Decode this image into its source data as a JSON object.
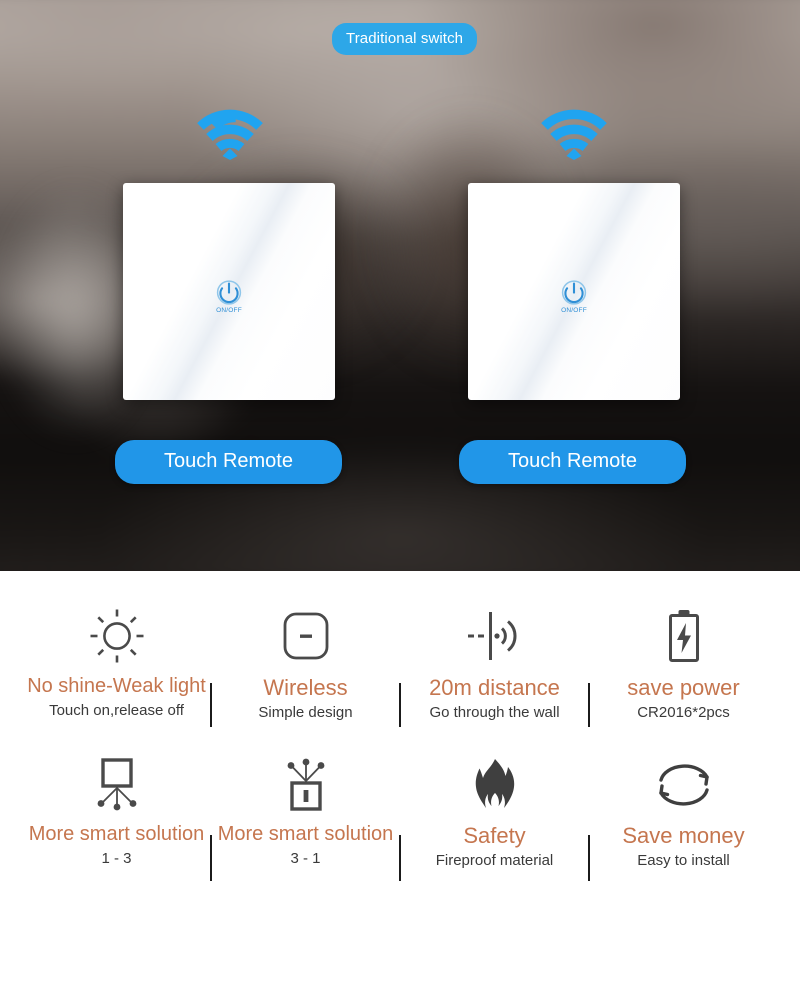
{
  "hero": {
    "badge": {
      "label": "Traditional switch"
    },
    "switches": [
      {
        "wifi_icon": "wifi-signal-icon",
        "power_icon": "power-onoff-icon",
        "power_label": "ON/OFF",
        "button_label": "Touch Remote"
      },
      {
        "wifi_icon": "wifi-signal-icon",
        "power_icon": "power-onoff-icon",
        "power_label": "ON/OFF",
        "button_label": "Touch Remote"
      }
    ]
  },
  "features": {
    "accent_color": "#c5764f",
    "subtext_color": "#3a3a3a",
    "badge_color": "#2da7e8",
    "button_color": "#2196e8",
    "row1": [
      {
        "icon": "sun-icon",
        "title": "No shine-Weak light",
        "subtitle": "Touch on,release off"
      },
      {
        "icon": "wireless-switch-icon",
        "title": "Wireless",
        "subtitle": "Simple design"
      },
      {
        "icon": "through-wall-signal-icon",
        "title": "20m distance",
        "subtitle": "Go through the wall"
      },
      {
        "icon": "battery-bolt-icon",
        "title": "save power",
        "subtitle": "CR2016*2pcs"
      }
    ],
    "row2": [
      {
        "icon": "one-to-three-icon",
        "title": "More smart solution",
        "subtitle": "1 - 3"
      },
      {
        "icon": "three-to-one-icon",
        "title": "More smart solution",
        "subtitle": "3 - 1"
      },
      {
        "icon": "flame-icon",
        "title": "Safety",
        "subtitle": "Fireproof material"
      },
      {
        "icon": "recycle-arrows-icon",
        "title": "Save money",
        "subtitle": "Easy to install"
      }
    ]
  }
}
